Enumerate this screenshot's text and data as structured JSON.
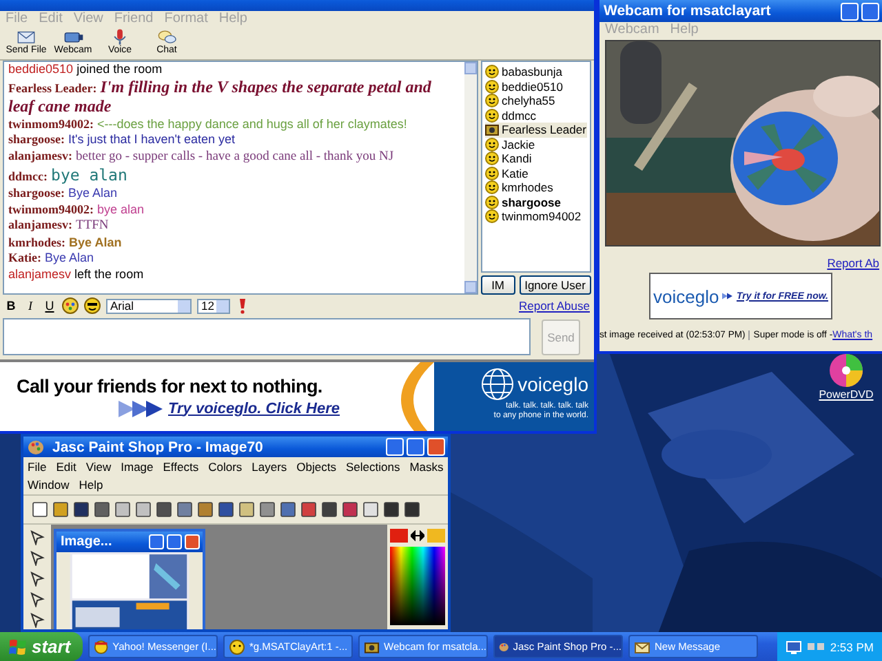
{
  "chat_window": {
    "menu": {
      "disabled": true,
      "items": [
        "File",
        "Edit",
        "View",
        "Friend",
        "Format",
        "Help"
      ]
    },
    "toolbar": [
      {
        "label": "Send File",
        "kind": "file"
      },
      {
        "label": "Webcam",
        "kind": "webcam"
      },
      {
        "label": "Voice",
        "kind": "voice"
      },
      {
        "label": "Chat",
        "kind": "chat"
      }
    ],
    "messages": [
      {
        "kind": "event",
        "user": "beddie0510",
        "text": "joined the room"
      },
      {
        "kind": "script",
        "user": "Fearless Leader:",
        "text": "I'm filling in the V shapes the separate petal and leaf cane made",
        "color": "#7a1030"
      },
      {
        "kind": "message",
        "user": "twinmom94002:",
        "text": "<---does the happy dance and hugs all of her claymates!",
        "color": "#6aa040"
      },
      {
        "kind": "message",
        "user": "shargoose:",
        "text": "It's just that I haven't eaten yet",
        "color": "#2a2aa0"
      },
      {
        "kind": "serif",
        "user": "alanjamesv:",
        "text": "better go - supper calls - have a good cane all - thank you NJ",
        "color": "#7a3a7a"
      },
      {
        "kind": "large",
        "user": "ddmcc:",
        "text": "bye alan",
        "color": "#207878"
      },
      {
        "kind": "message",
        "user": "shargoose:",
        "text": "Bye Alan",
        "color": "#3a3ab0"
      },
      {
        "kind": "message",
        "user": "twinmom94002:",
        "text": "bye alan",
        "color": "#c04090"
      },
      {
        "kind": "serif",
        "user": "alanjamesv:",
        "text": "TTFN",
        "color": "#7a3a7a"
      },
      {
        "kind": "bold",
        "user": "kmrhodes:",
        "text": "Bye Alan",
        "color": "#a07020"
      },
      {
        "kind": "message",
        "user": "Katie:",
        "text": "Bye Alan",
        "color": "#3a3ab0"
      },
      {
        "kind": "event",
        "user": "alanjamesv",
        "text": "left the room"
      }
    ],
    "users": [
      {
        "name": "babasbunja",
        "kind": "smiley",
        "selected": false,
        "bold": false
      },
      {
        "name": "beddie0510",
        "kind": "smiley",
        "selected": false,
        "bold": false
      },
      {
        "name": "chelyha55",
        "kind": "smiley",
        "selected": false,
        "bold": false
      },
      {
        "name": "ddmcc",
        "kind": "smiley",
        "selected": false,
        "bold": false
      },
      {
        "name": "Fearless Leader",
        "kind": "webcam",
        "selected": true,
        "bold": false
      },
      {
        "name": "Jackie",
        "kind": "smiley",
        "selected": false,
        "bold": false
      },
      {
        "name": "Kandi",
        "kind": "smiley",
        "selected": false,
        "bold": false
      },
      {
        "name": "Katie",
        "kind": "smiley",
        "selected": false,
        "bold": false
      },
      {
        "name": "kmrhodes",
        "kind": "smiley",
        "selected": false,
        "bold": false
      },
      {
        "name": "shargoose",
        "kind": "smiley",
        "selected": false,
        "bold": true
      },
      {
        "name": "twinmom94002",
        "kind": "smiley",
        "selected": false,
        "bold": false
      }
    ],
    "user_buttons": [
      "IM",
      "Ignore User"
    ],
    "format_bar": {
      "bold": "B",
      "italic": "I",
      "underline": "U",
      "font": "Arial",
      "size": "12",
      "report": "Report Abuse"
    },
    "send_button": {
      "label": "Send",
      "disabled": true
    },
    "ad": {
      "headline": "Call your friends for next to nothing.",
      "link": "Try voiceglo. Click Here",
      "brand": "voiceglo",
      "tagline": [
        "talk. talk. talk. talk. talk",
        "to any phone in the world."
      ]
    }
  },
  "webcam_window": {
    "title": "Webcam for msatclayart",
    "menu": {
      "disabled": true,
      "items": [
        "Webcam",
        "Help"
      ]
    },
    "report": "Report Ab",
    "ad": {
      "brand": "voiceglo",
      "link": "Try it for FREE now."
    },
    "status": {
      "received": "st image received at (02:53:07 PM)",
      "mode": "Super mode is off - ",
      "link": "What's th"
    }
  },
  "desktop_icons": [
    {
      "label": "PowerDVD"
    }
  ],
  "psp_window": {
    "title": "Jasc Paint Shop Pro - Image70",
    "menu": [
      "File",
      "Edit",
      "View",
      "Image",
      "Effects",
      "Colors",
      "Layers",
      "Objects",
      "Selections",
      "Masks",
      "Window",
      "Help"
    ],
    "image_window": {
      "title": "Image..."
    }
  },
  "taskbar": {
    "start": "start",
    "buttons": [
      {
        "label": "Yahoo! Messenger (I...",
        "kind": "messenger",
        "selected": false
      },
      {
        "label": "*g.MSATClayArt:1 -...",
        "kind": "chat",
        "selected": false
      },
      {
        "label": "Webcam for msatcla...",
        "kind": "webcam",
        "selected": false
      },
      {
        "label": "Jasc Paint Shop Pro -...",
        "kind": "paint",
        "selected": true
      },
      {
        "label": "New Message",
        "kind": "message",
        "selected": false
      }
    ],
    "clock": "2:53 PM"
  }
}
